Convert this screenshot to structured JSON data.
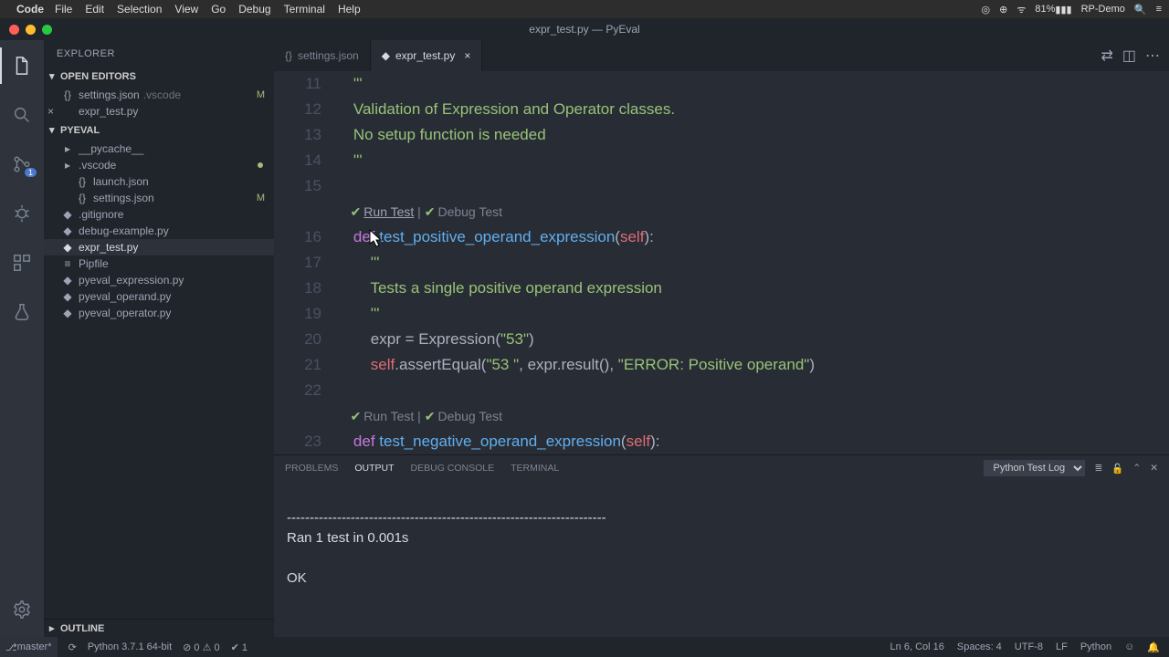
{
  "menubar": {
    "app": "Code",
    "items": [
      "File",
      "Edit",
      "Selection",
      "View",
      "Go",
      "Debug",
      "Terminal",
      "Help"
    ],
    "right": {
      "battery": "81%",
      "user": "RP-Demo"
    }
  },
  "titlebar": {
    "title": "expr_test.py — PyEval"
  },
  "sidebar": {
    "header": "EXPLORER",
    "open_editors_label": "OPEN EDITORS",
    "open_editors": [
      {
        "name": "settings.json",
        "folder": ".vscode",
        "m": true
      },
      {
        "name": "expr_test.py",
        "close": true
      }
    ],
    "project": "PYEVAL",
    "files": [
      {
        "name": "__pycache__",
        "folder": true,
        "indent": 1
      },
      {
        "name": ".vscode",
        "folder": true,
        "indent": 1,
        "dot": true
      },
      {
        "name": "launch.json",
        "indent": 2,
        "icon": "{}"
      },
      {
        "name": "settings.json",
        "indent": 2,
        "icon": "{}",
        "m": true
      },
      {
        "name": ".gitignore",
        "indent": 1,
        "icon": "◆"
      },
      {
        "name": "debug-example.py",
        "indent": 1,
        "icon": "py"
      },
      {
        "name": "expr_test.py",
        "indent": 1,
        "icon": "py",
        "sel": true
      },
      {
        "name": "Pipfile",
        "indent": 1,
        "icon": "≡"
      },
      {
        "name": "pyeval_expression.py",
        "indent": 1,
        "icon": "py"
      },
      {
        "name": "pyeval_operand.py",
        "indent": 1,
        "icon": "py"
      },
      {
        "name": "pyeval_operator.py",
        "indent": 1,
        "icon": "py"
      }
    ],
    "outline_label": "OUTLINE"
  },
  "tabs": {
    "items": [
      {
        "name": "settings.json",
        "icon": "{}"
      },
      {
        "name": "expr_test.py",
        "icon": "py",
        "active": true,
        "dirty": true
      }
    ]
  },
  "code": {
    "lines": [
      {
        "n": 11,
        "frag": [
          {
            "t": "    '''",
            "c": "cmt"
          }
        ]
      },
      {
        "n": 12,
        "frag": [
          {
            "t": "    Validation of Expression and Operator classes.",
            "c": "cmt"
          }
        ]
      },
      {
        "n": 13,
        "frag": [
          {
            "t": "    No setup function is needed",
            "c": "cmt"
          }
        ]
      },
      {
        "n": 14,
        "frag": [
          {
            "t": "    '''",
            "c": "cmt"
          }
        ]
      },
      {
        "n": 15,
        "frag": [
          {
            "t": " "
          }
        ]
      },
      {
        "lens": true,
        "hover": true,
        "run": "Run Test",
        "debug": "Debug Test"
      },
      {
        "n": 16,
        "frag": [
          {
            "t": "    "
          },
          {
            "t": "def",
            "c": "kw"
          },
          {
            "t": " "
          },
          {
            "t": "test_positive_operand_expression",
            "c": "fn"
          },
          {
            "t": "("
          },
          {
            "t": "self",
            "c": "slf"
          },
          {
            "t": "):"
          }
        ]
      },
      {
        "n": 17,
        "frag": [
          {
            "t": "        '''",
            "c": "cmt"
          }
        ]
      },
      {
        "n": 18,
        "frag": [
          {
            "t": "        Tests a single positive operand expression",
            "c": "cmt"
          }
        ]
      },
      {
        "n": 19,
        "frag": [
          {
            "t": "        '''",
            "c": "cmt"
          }
        ]
      },
      {
        "n": 20,
        "frag": [
          {
            "t": "        expr = Expression("
          },
          {
            "t": "\"53\"",
            "c": "str"
          },
          {
            "t": ")"
          }
        ]
      },
      {
        "n": 21,
        "frag": [
          {
            "t": "        "
          },
          {
            "t": "self",
            "c": "slf"
          },
          {
            "t": ".assertEqual("
          },
          {
            "t": "\"53 \"",
            "c": "str"
          },
          {
            "t": ", expr.result(), "
          },
          {
            "t": "\"ERROR: Positive operand\"",
            "c": "str"
          },
          {
            "t": ")"
          }
        ]
      },
      {
        "n": 22,
        "frag": [
          {
            "t": " "
          }
        ]
      },
      {
        "lens": true,
        "run": "Run Test",
        "debug": "Debug Test"
      },
      {
        "n": 23,
        "frag": [
          {
            "t": "    "
          },
          {
            "t": "def",
            "c": "kw"
          },
          {
            "t": " "
          },
          {
            "t": "test_negative_operand_expression",
            "c": "fn"
          },
          {
            "t": "("
          },
          {
            "t": "self",
            "c": "slf"
          },
          {
            "t": "):"
          }
        ]
      }
    ]
  },
  "panel": {
    "tabs": [
      "PROBLEMS",
      "OUTPUT",
      "DEBUG CONSOLE",
      "TERMINAL"
    ],
    "active": "OUTPUT",
    "dropdown": "Python Test Log",
    "body": [
      "----------------------------------------------------------------------",
      "Ran 1 test in 0.001s",
      "",
      "OK"
    ]
  },
  "status": {
    "branch": "master*",
    "python": "Python 3.7.1 64-bit",
    "errs": "⊘ 0  ⚠ 0",
    "tests": "✔ 1",
    "lncol": "Ln 6, Col 16",
    "spaces": "Spaces: 4",
    "enc": "UTF-8",
    "eol": "LF",
    "lang": "Python",
    "feedback": "☺"
  }
}
